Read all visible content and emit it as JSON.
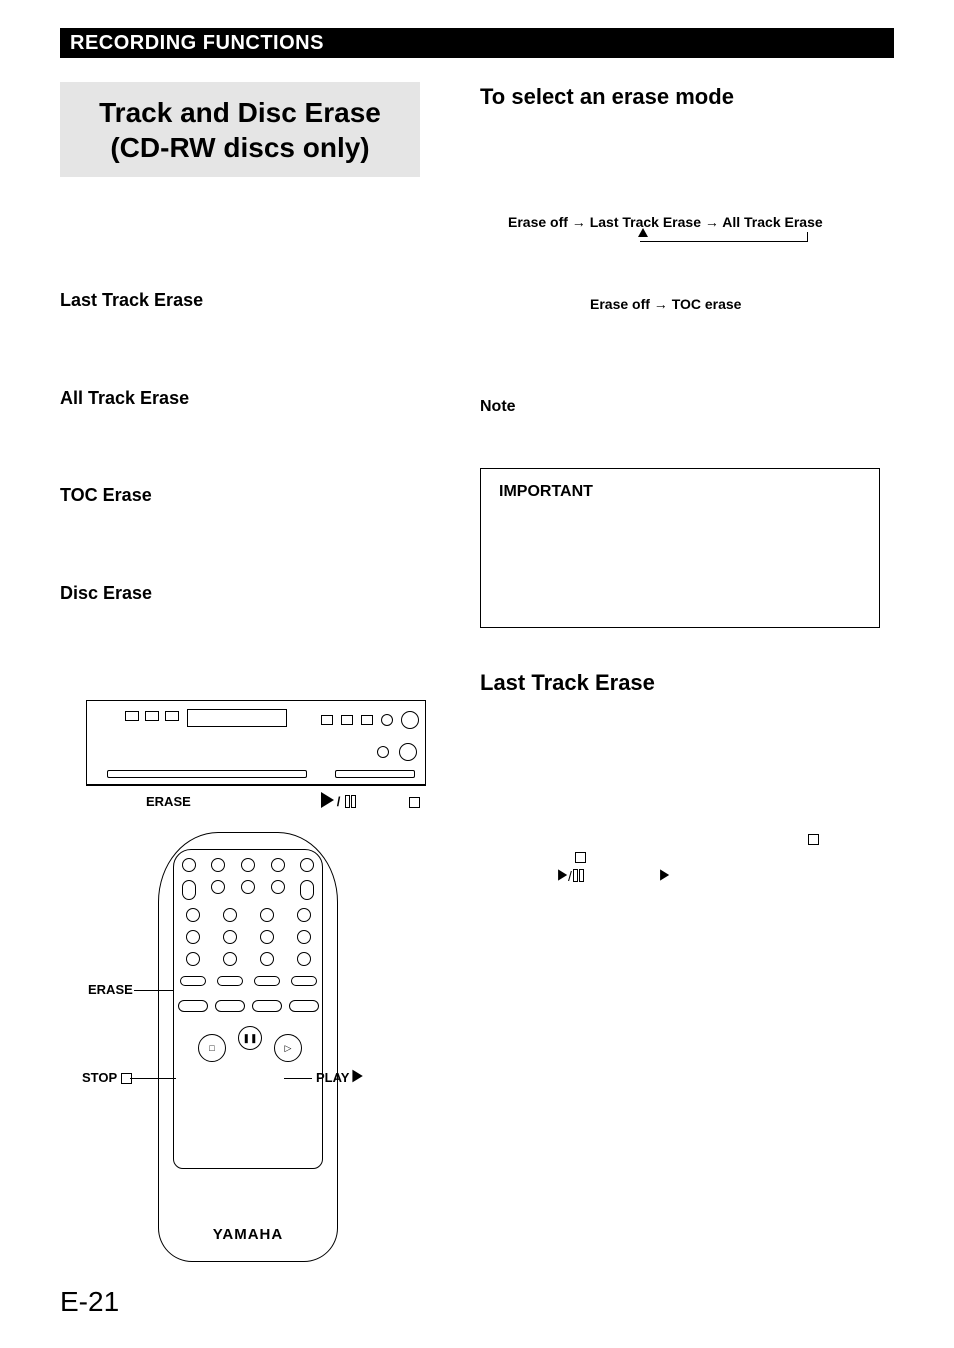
{
  "header": {
    "title": "RECORDING FUNCTIONS"
  },
  "titleBox": {
    "line1": "Track and Disc Erase",
    "line2": "(CD-RW discs only)"
  },
  "rightHeading1": "To select an erase mode",
  "leftHeadings": {
    "lastTrack": "Last Track Erase",
    "allTrack": "All Track Erase",
    "tocErase": "TOC Erase",
    "discErase": "Disc Erase"
  },
  "diagrams": {
    "line1": "Erase off → Last Track Erase → All Track Erase",
    "line2": "Erase off → TOC erase"
  },
  "noteLabel": "Note",
  "importantLabel": "IMPORTANT",
  "rightHeading2": "Last Track Erase",
  "deviceLabels": {
    "erase": "ERASE",
    "playpause": "▷/𝄁",
    "stop": "□"
  },
  "remote": {
    "eraseLabel": "ERASE",
    "stopLabel": "STOP □",
    "playLabel": "PLAY ▷",
    "brand": "YAMAHA"
  },
  "pageNumber": "E-21"
}
